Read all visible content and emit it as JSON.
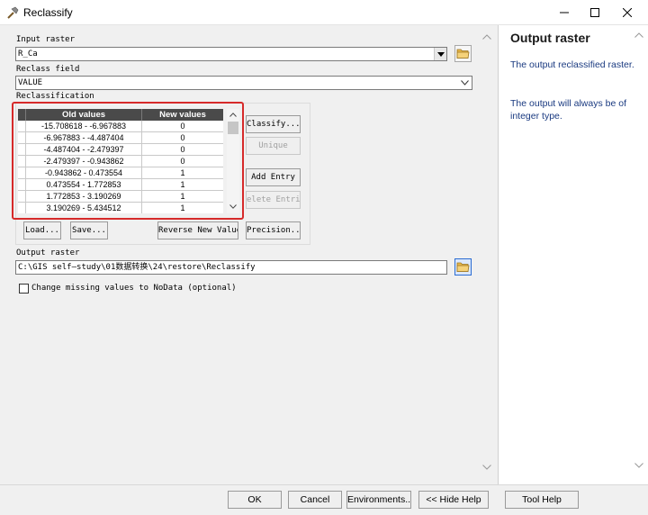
{
  "window": {
    "title": "Reclassify",
    "icon": "hammer-icon"
  },
  "form": {
    "input_raster_label": "Input raster",
    "input_raster_value": "R_Ca",
    "reclass_field_label": "Reclass field",
    "reclass_field_value": "VALUE",
    "reclassification_label": "Reclassification",
    "table": {
      "headers": [
        "Old values",
        "New values"
      ],
      "rows": [
        {
          "old": "-15.708618 - -6.967883",
          "new": "0"
        },
        {
          "old": "-6.967883 - -4.487404",
          "new": "0"
        },
        {
          "old": "-4.487404 - -2.479397",
          "new": "0"
        },
        {
          "old": "-2.479397 - -0.943862",
          "new": "0"
        },
        {
          "old": "-0.943862 - 0.473554",
          "new": "1"
        },
        {
          "old": "0.473554 - 1.772853",
          "new": "1"
        },
        {
          "old": "1.772853 - 3.190269",
          "new": "1"
        },
        {
          "old": "3.190269 - 5.434512",
          "new": "1"
        }
      ]
    },
    "buttons": {
      "classify": "Classify...",
      "unique": "Unique",
      "add_entry": "Add Entry",
      "delete_entries": "elete Entrie",
      "load": "Load...",
      "save": "Save...",
      "reverse": "Reverse New Values",
      "precision": "Precision..."
    },
    "output_raster_label": "Output raster",
    "output_raster_value": "C:\\GIS  self—study\\01数据转换\\24\\restore\\Reclassify",
    "change_missing_label": "Change missing values to NoData (optional)",
    "change_missing_checked": false
  },
  "help": {
    "title": "Output raster",
    "p1": "The output reclassified raster.",
    "p2": "The output will always be of integer type."
  },
  "footer": {
    "ok": "OK",
    "cancel": "Cancel",
    "environments": "Environments...",
    "hide_help": "<< Hide Help",
    "tool_help": "Tool Help"
  },
  "colors": {
    "highlight": "#d62a2a",
    "table_header": "#4a4a4a",
    "help_text": "#1a3a80"
  }
}
